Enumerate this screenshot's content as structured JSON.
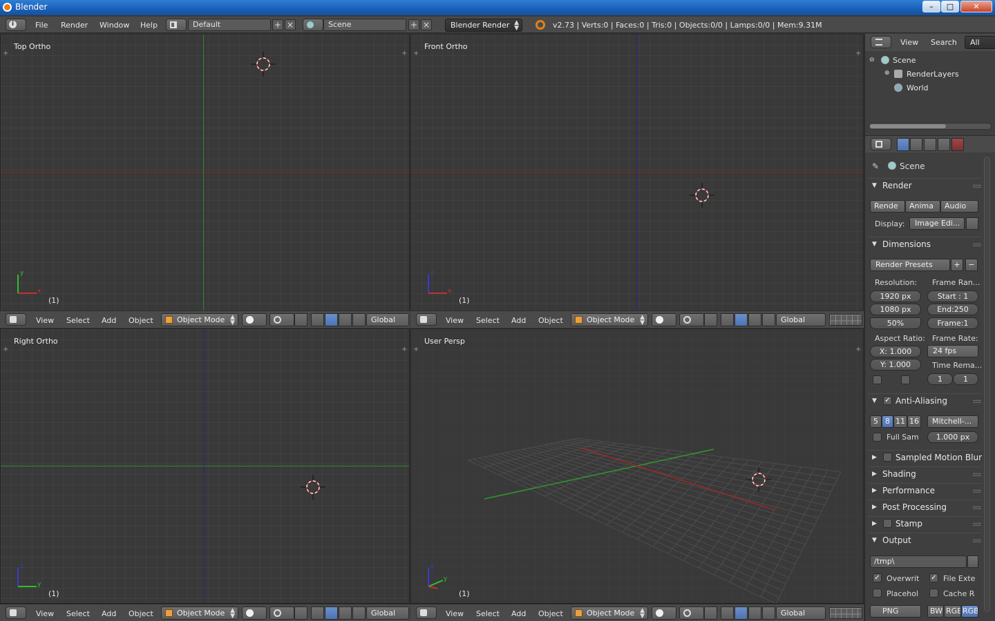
{
  "window": {
    "title": "Blender",
    "controls": {
      "minimize": "–",
      "maximize": "□",
      "close": "✕"
    }
  },
  "info_header": {
    "menus": [
      "File",
      "Render",
      "Window",
      "Help"
    ],
    "screen_layout": "Default",
    "scene": "Scene",
    "render_engine": "Blender Render",
    "stats": "v2.73 | Verts:0 | Faces:0 | Tris:0 | Objects:0/0 | Lamps:0/0 | Mem:9.31M"
  },
  "viewports": [
    {
      "label": "Top Ortho",
      "frame": "(1)",
      "axes": [
        "y",
        "x"
      ],
      "colors": {
        "h": "#8a2525",
        "v": "#2f8a2f"
      }
    },
    {
      "label": "Front Ortho",
      "frame": "(1)",
      "axes": [
        "z",
        "x"
      ],
      "colors": {
        "h": "#8a2525",
        "v": "#27278a"
      }
    },
    {
      "label": "Right Ortho",
      "frame": "(1)",
      "axes": [
        "z",
        "y"
      ],
      "colors": {
        "h": "#2f8a2f",
        "v": "#27278a"
      }
    },
    {
      "label": "User Persp",
      "frame": "(1)",
      "axes": [
        "z",
        "y"
      ]
    }
  ],
  "view3d_header": {
    "menus": [
      "View",
      "Select",
      "Add",
      "Object"
    ],
    "mode": "Object Mode",
    "orientation": "Global"
  },
  "outliner": {
    "menus": [
      "View",
      "Search"
    ],
    "filter": "All Scen",
    "tree": [
      "Scene",
      "RenderLayers",
      "World"
    ]
  },
  "properties": {
    "context": "Scene",
    "render": {
      "title": "Render",
      "buttons": [
        "Rende",
        "Anima",
        "Audio"
      ],
      "display_label": "Display:",
      "display_value": "Image Edi..."
    },
    "dimensions": {
      "title": "Dimensions",
      "presets": "Render Presets",
      "resolution_label": "Resolution:",
      "res_x": "1920 px",
      "res_y": "1080 px",
      "res_pct": "50%",
      "frame_range_label": "Frame Ran...",
      "start": "Start : 1",
      "end": "End:250",
      "frame": "Frame:1",
      "aspect_label": "Aspect Ratio:",
      "aspect_x": "X: 1.000",
      "aspect_y": "Y: 1.000",
      "frame_rate_label": "Frame Rate:",
      "fps": "24 fps",
      "time_remap_label": "Time Rema...",
      "remap_old": "1",
      "remap_new": "1"
    },
    "anti_aliasing": {
      "title": "Anti-Aliasing",
      "samples": [
        "5",
        "8",
        "11",
        "16"
      ],
      "filter": "Mitchell-...",
      "full_sample": "Full Sam",
      "size": "1.000 px"
    },
    "collapsed_panels": [
      "Sampled Motion Blur",
      "Shading",
      "Performance",
      "Post Processing",
      "Stamp"
    ],
    "output": {
      "title": "Output",
      "path": "/tmp\\",
      "overwrite": "Overwrit",
      "file_ext": "File Exte",
      "placeholders": "Placehol",
      "cache": "Cache R",
      "format": "PNG",
      "color_modes": [
        "BW",
        "RGB",
        "RGBA"
      ]
    }
  },
  "colors": {
    "accent_blue": "#5680c2",
    "header": "#4a4a4a",
    "viewport_bg": "#393939"
  }
}
